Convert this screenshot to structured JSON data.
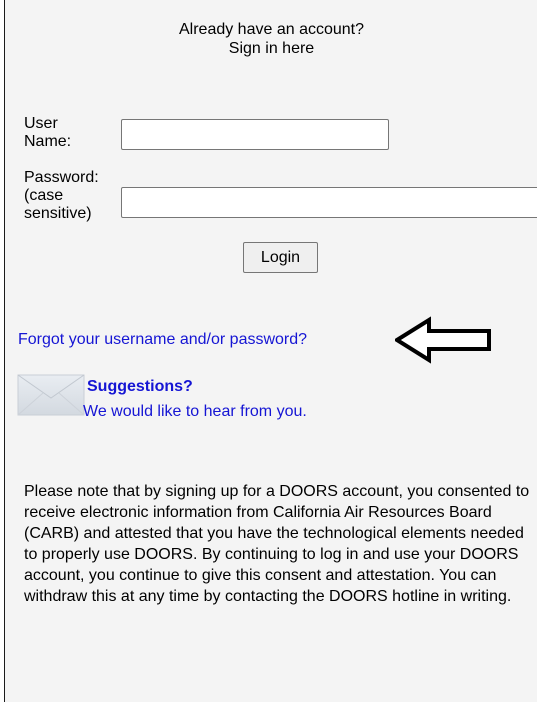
{
  "header": {
    "line1": "Already have an account?",
    "line2": "Sign in here"
  },
  "form": {
    "username": {
      "label_line1": "User",
      "label_line2": "Name:",
      "value": ""
    },
    "password": {
      "label_line1": "Password:",
      "label_line2": "(case",
      "label_line3": "sensitive)",
      "value": ""
    },
    "login_label": "Login"
  },
  "links": {
    "forgot": "Forgot your username and/or password?"
  },
  "suggestions": {
    "title": "Suggestions?",
    "subtitle": "We would like to hear from you."
  },
  "notice": {
    "text": "Please note that by signing up for a DOORS account, you consented to receive electronic information from California Air Resources Board (CARB) and attested that you have the technological elements needed to properly use DOORS. By continuing to log in and use your DOORS account, you continue to give this consent and attestation. You can withdraw this at any time by contacting the DOORS hotline in writing."
  },
  "icons": {
    "arrow": "arrow-left-icon",
    "envelope": "envelope-icon"
  },
  "colors": {
    "panel_bg": "#f4f4f4",
    "link": "#1515d4"
  }
}
